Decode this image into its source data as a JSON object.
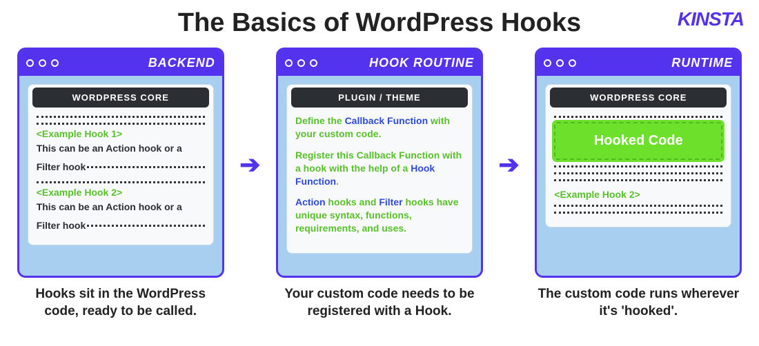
{
  "brand": "KINSTA",
  "title": "The Basics of WordPress Hooks",
  "panels": [
    {
      "titlebar": "BACKEND",
      "inner_head": "WORDPRESS CORE",
      "hook1": "<Example Hook 1>",
      "desc1a": "This can be an Action hook or a",
      "desc1b": "Filter hook",
      "hook2": "<Example Hook 2>",
      "desc2a": "This can be an Action hook or a",
      "desc2b": "Filter hook",
      "caption": "Hooks sit in the WordPress code, ready to be called."
    },
    {
      "titlebar": "HOOK ROUTINE",
      "inner_head": "PLUGIN / THEME",
      "line1_a": "Define the ",
      "line1_cb": "Callback Function",
      "line1_b": " with your custom code.",
      "line2_a": "Register this Callback Function with a hook with the help of a ",
      "line2_hf": "Hook Function",
      "line2_b": ".",
      "line3_a": "Action",
      "line3_b": " hooks and ",
      "line3_c": "Filter",
      "line3_d": " hooks have unique syntax, functions, requirements, and uses.",
      "caption": "Your custom code needs to be registered with a Hook."
    },
    {
      "titlebar": "RUNTIME",
      "inner_head": "WORDPRESS CORE",
      "badge": "Hooked Code",
      "hook2": "<Example Hook 2>",
      "caption": "The custom code runs wherever it's 'hooked'."
    }
  ]
}
